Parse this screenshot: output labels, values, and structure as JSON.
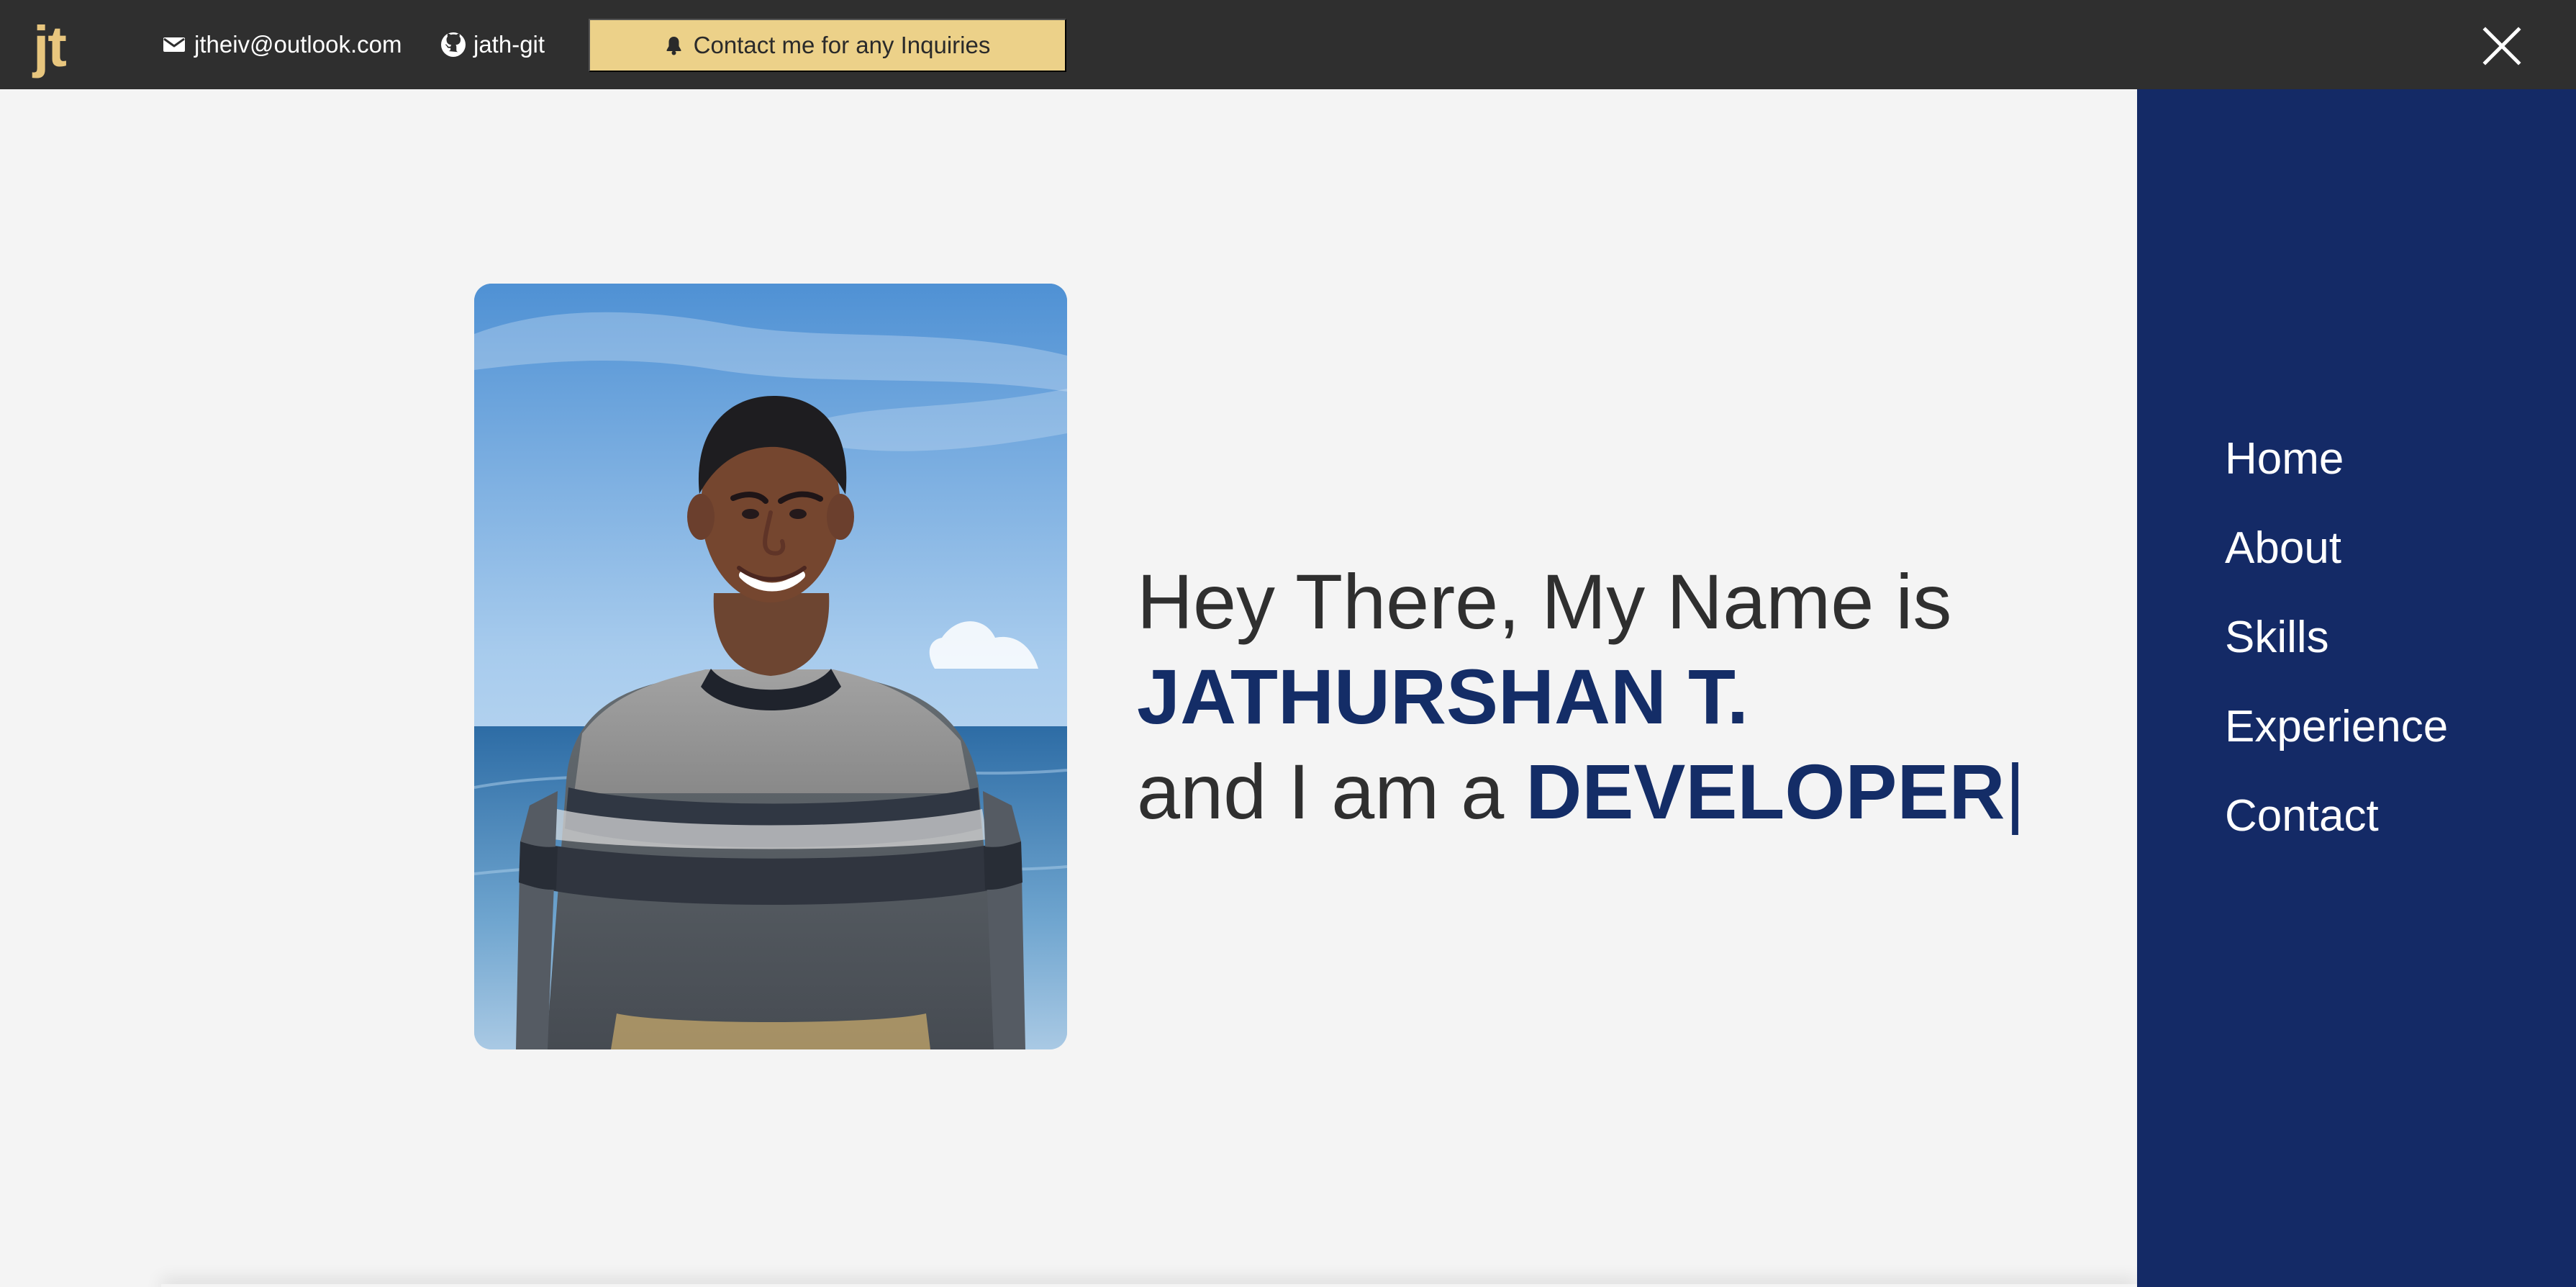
{
  "header": {
    "logo_text": "jt",
    "email": "jtheiv@outlook.com",
    "github": "jath-git",
    "contact_button": "Contact me for any Inquiries",
    "icons": [
      "email-icon",
      "github-icon",
      "bell-icon",
      "close-icon"
    ]
  },
  "hero": {
    "line_one": "Hey There, My Name is",
    "name": "JATHURSHAN T.",
    "line_three_prefix": "and I am a",
    "role": "DEVELOPER",
    "cursor": "|"
  },
  "sidebar": {
    "items": [
      {
        "label": "Home"
      },
      {
        "label": "About"
      },
      {
        "label": "Skills"
      },
      {
        "label": "Experience"
      },
      {
        "label": "Contact"
      }
    ]
  },
  "colors": {
    "header_background": "#2f2f2f",
    "logo": "#e8c67e",
    "contact_button": "#ecd189",
    "sidebar": "#142a66",
    "accent_text": "#142d67",
    "page_background": "#f4f4f4"
  }
}
